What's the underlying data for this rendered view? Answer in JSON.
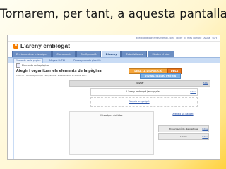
{
  "slide_title": "Tornarem, per tant, a aquesta pantalla",
  "topbar": {
    "email": "adelaloadelcontreras@gmail.com",
    "links": [
      "Tauler",
      "El meu compte",
      "Ajuda",
      "Surt"
    ]
  },
  "brand": {
    "logo_letter": "B",
    "name": "L'areny emblogat"
  },
  "tabs": [
    "Enviament de missatges",
    "Comentaris",
    "Configuració",
    "Disseny",
    "Estadístiques",
    "Mostra el bloc"
  ],
  "subtabs": [
    "Elements de la pàgina",
    "Afegeix l'HTML",
    "Dissenyador de plantilla"
  ],
  "pane": {
    "breadcrumb": "Elements de la pàgina",
    "heading": "Afegir i organitzar els elements de la pàgina",
    "subheading": "Feu clic i arrossegueu per reorganitzar els elements al vostre bloc.",
    "btn_save": "DESA LA DISPOSICIÓ",
    "btn_save2": "DESA",
    "btn_preview": "VISUALITZACIÓ PRÈVIA"
  },
  "layout": {
    "navbar": "Navbar",
    "navbar_edit": "Edita",
    "header": "L'areny emblogat (encapçala...",
    "header_edit": "Edita",
    "add_gadget_top": "Afegeix un gadget",
    "blog_posts": "Missatges del bloc",
    "add_gadget_side": "Afegeix un gadget",
    "gadget_1": "Presentació de diapositives",
    "gadget_1_edit": "Edita",
    "gadget_2": "L'arxiu",
    "gadget_2_edit": "Edita"
  }
}
